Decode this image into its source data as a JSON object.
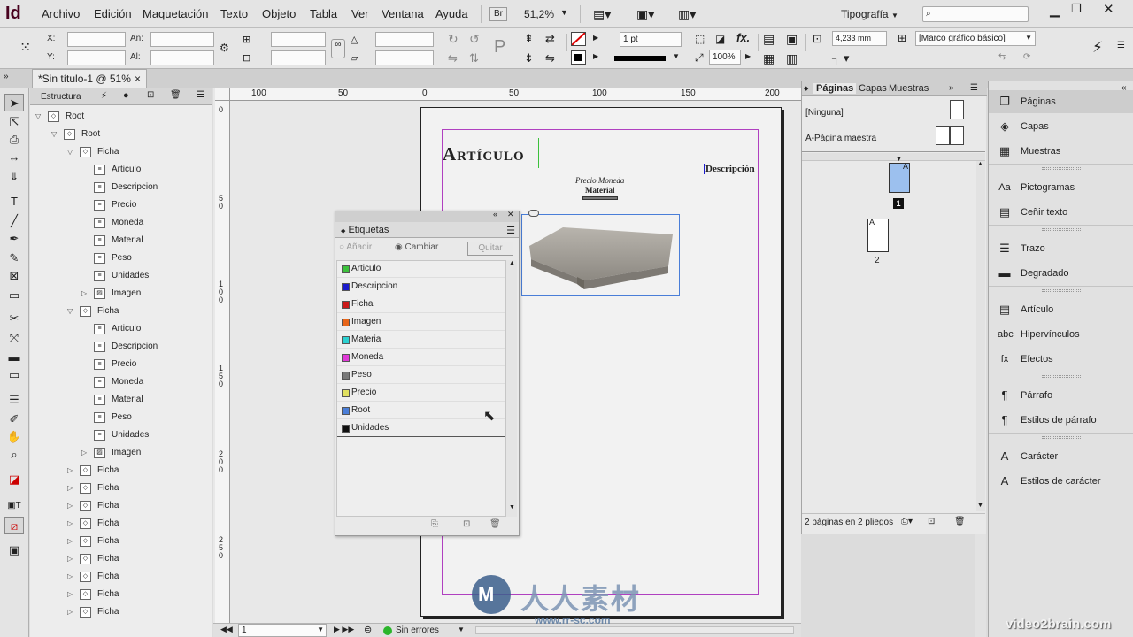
{
  "app": {
    "logo": "Id",
    "menu": [
      "Archivo",
      "Edición",
      "Maquetación",
      "Texto",
      "Objeto",
      "Tabla",
      "Ver",
      "Ventana",
      "Ayuda"
    ],
    "bridge": "Br",
    "zoom": "51,2%",
    "workspace": "Tipografía",
    "search_placeholder": ""
  },
  "control": {
    "x_label": "X:",
    "y_label": "Y:",
    "w_label": "An:",
    "h_label": "Al:",
    "stroke_weight": "1 pt",
    "offset": "4,233 mm",
    "scale": "100%",
    "object_style": "[Marco gráfico básico]",
    "fx_label": "fx."
  },
  "document": {
    "tab_title": "*Sin título-1 @ 51%",
    "close": "×",
    "ruler_h": [
      "100",
      "50",
      "0",
      "50",
      "100",
      "150",
      "200"
    ],
    "ruler_v": [
      "0",
      "5\n0",
      "1\n0\n0",
      "1\n5\n0",
      "2\n0\n0",
      "2\n5\n0"
    ],
    "heading": "Artículo",
    "descripcion": "Descripción",
    "precio_moneda": "Precio Moneda",
    "material": "Material"
  },
  "structure": {
    "title": "Estructura",
    "nodes": [
      {
        "label": "Root",
        "level": 0,
        "open": true,
        "type": "root"
      },
      {
        "label": "Root",
        "level": 1,
        "open": true,
        "type": "root"
      },
      {
        "label": "Ficha",
        "level": 2,
        "open": true,
        "type": "ficha"
      },
      {
        "label": "Articulo",
        "level": 3,
        "type": "text"
      },
      {
        "label": "Descripcion",
        "level": 3,
        "type": "text"
      },
      {
        "label": "Precio",
        "level": 3,
        "type": "text"
      },
      {
        "label": "Moneda",
        "level": 3,
        "type": "text"
      },
      {
        "label": "Material",
        "level": 3,
        "type": "text"
      },
      {
        "label": "Peso",
        "level": 3,
        "type": "text"
      },
      {
        "label": "Unidades",
        "level": 3,
        "type": "text"
      },
      {
        "label": "Imagen",
        "level": 3,
        "open": false,
        "type": "image"
      },
      {
        "label": "Ficha",
        "level": 2,
        "open": true,
        "type": "ficha"
      },
      {
        "label": "Articulo",
        "level": 3,
        "type": "text"
      },
      {
        "label": "Descripcion",
        "level": 3,
        "type": "text"
      },
      {
        "label": "Precio",
        "level": 3,
        "type": "text"
      },
      {
        "label": "Moneda",
        "level": 3,
        "type": "text"
      },
      {
        "label": "Material",
        "level": 3,
        "type": "text"
      },
      {
        "label": "Peso",
        "level": 3,
        "type": "text"
      },
      {
        "label": "Unidades",
        "level": 3,
        "type": "text"
      },
      {
        "label": "Imagen",
        "level": 3,
        "open": false,
        "type": "image"
      },
      {
        "label": "Ficha",
        "level": 2,
        "open": false,
        "type": "root"
      },
      {
        "label": "Ficha",
        "level": 2,
        "open": false,
        "type": "root"
      },
      {
        "label": "Ficha",
        "level": 2,
        "open": false,
        "type": "root"
      },
      {
        "label": "Ficha",
        "level": 2,
        "open": false,
        "type": "root"
      },
      {
        "label": "Ficha",
        "level": 2,
        "open": false,
        "type": "root"
      },
      {
        "label": "Ficha",
        "level": 2,
        "open": false,
        "type": "root"
      },
      {
        "label": "Ficha",
        "level": 2,
        "open": false,
        "type": "root"
      },
      {
        "label": "Ficha",
        "level": 2,
        "open": false,
        "type": "root"
      },
      {
        "label": "Ficha",
        "level": 2,
        "open": false,
        "type": "root"
      }
    ]
  },
  "tags": {
    "title": "Etiquetas",
    "add": "Añadir",
    "change": "Cambiar",
    "remove": "Quitar",
    "items": [
      {
        "name": "Articulo",
        "color": "#3cc13c"
      },
      {
        "name": "Descripcion",
        "color": "#1a1acc"
      },
      {
        "name": "Ficha",
        "color": "#cc1a1a"
      },
      {
        "name": "Imagen",
        "color": "#e8661a"
      },
      {
        "name": "Material",
        "color": "#2ad0d0"
      },
      {
        "name": "Moneda",
        "color": "#e03ad8"
      },
      {
        "name": "Peso",
        "color": "#7a7a7a"
      },
      {
        "name": "Precio",
        "color": "#e0e060"
      },
      {
        "name": "Root",
        "color": "#4a7ed8"
      },
      {
        "name": "Unidades",
        "color": "#111111"
      }
    ]
  },
  "pages": {
    "tabs": [
      "Páginas",
      "Capas",
      "Muestras"
    ],
    "none": "[Ninguna]",
    "master": "A-Página maestra",
    "page1": "1",
    "page2": "2",
    "page1_master": "A",
    "page2_master": "A",
    "footer": "2 páginas en 2 pliegos"
  },
  "dock": {
    "items": [
      {
        "label": "Páginas",
        "icon": "pages-icon",
        "glyph": "❐",
        "active": true
      },
      {
        "label": "Capas",
        "icon": "layers-icon",
        "glyph": "◈"
      },
      {
        "label": "Muestras",
        "icon": "swatches-icon",
        "glyph": "▦"
      },
      {
        "label": "Pictogramas",
        "icon": "glyphs-icon",
        "glyph": "Aa"
      },
      {
        "label": "Ceñir texto",
        "icon": "text-wrap-icon",
        "glyph": "▤"
      },
      {
        "label": "Trazo",
        "icon": "stroke-icon",
        "glyph": "☰"
      },
      {
        "label": "Degradado",
        "icon": "gradient-icon",
        "glyph": "▬"
      },
      {
        "label": "Artículo",
        "icon": "article-icon",
        "glyph": "▤"
      },
      {
        "label": "Hipervínculos",
        "icon": "hyperlinks-icon",
        "glyph": "abc"
      },
      {
        "label": "Efectos",
        "icon": "effects-icon",
        "glyph": "fx"
      },
      {
        "label": "Párrafo",
        "icon": "paragraph-icon",
        "glyph": "¶"
      },
      {
        "label": "Estilos de párrafo",
        "icon": "paragraph-styles-icon",
        "glyph": "¶"
      },
      {
        "label": "Carácter",
        "icon": "character-icon",
        "glyph": "A"
      },
      {
        "label": "Estilos de carácter",
        "icon": "character-styles-icon",
        "glyph": "A"
      }
    ]
  },
  "status": {
    "page": "1",
    "errors": "Sin errores"
  },
  "watermark": {
    "site": "video2brain.com",
    "logo_text": "人人素材",
    "logo_url": "www.rr-sc.com"
  }
}
